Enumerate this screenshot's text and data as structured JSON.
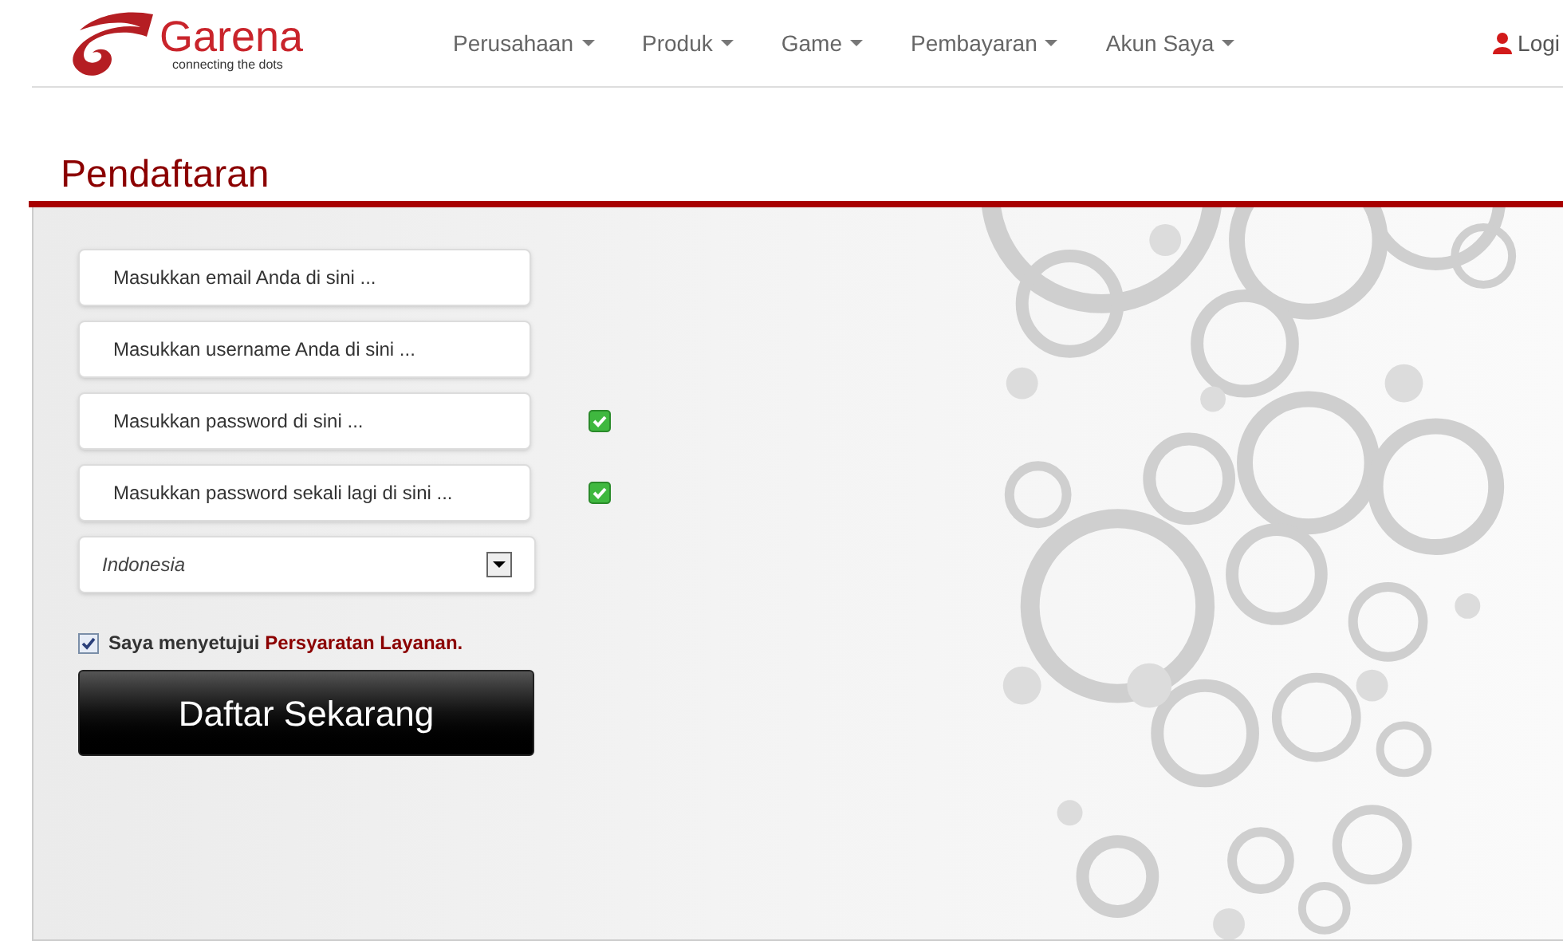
{
  "logo": {
    "name": "Garena",
    "tagline": "connecting the dots"
  },
  "nav": [
    {
      "label": "Perusahaan"
    },
    {
      "label": "Produk"
    },
    {
      "label": "Game"
    },
    {
      "label": "Pembayaran"
    },
    {
      "label": "Akun Saya"
    }
  ],
  "login": {
    "label": "Logi"
  },
  "page_title": "Pendaftaran",
  "fields": [
    {
      "placeholder": "Masukkan email Anda di sini ...",
      "valid": false
    },
    {
      "placeholder": "Masukkan username Anda di sini ...",
      "valid": false
    },
    {
      "placeholder": "Masukkan password di sini ...",
      "valid": true
    },
    {
      "placeholder": "Masukkan password sekali lagi di sini ...",
      "valid": true
    }
  ],
  "country_select": {
    "value": "Indonesia"
  },
  "agreement": {
    "checked": true,
    "text": "Saya menyetujui",
    "link": "Persyaratan Layanan."
  },
  "submit_button": "Daftar Sekarang"
}
